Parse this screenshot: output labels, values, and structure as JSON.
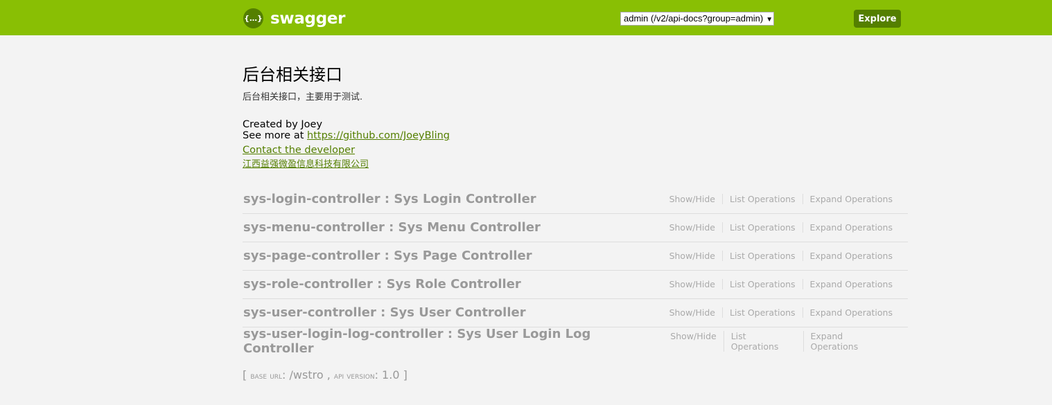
{
  "header": {
    "logo_glyph": "{…}",
    "brand": "swagger",
    "select_value": "admin (/v2/api-docs?group=admin)",
    "explore_label": "Explore",
    "color": "#89bf04"
  },
  "info": {
    "title": "后台相关接口",
    "description": "后台相关接口，主要用于测试.",
    "created_by": "Created by Joey",
    "see_more": "See more at ",
    "github_url": "https://github.com/JoeyBling",
    "contact": "Contact the developer",
    "company": "江西益强微盈信息科技有限公司"
  },
  "ops": {
    "show_hide": "Show/Hide",
    "list": "List Operations",
    "expand": "Expand Operations"
  },
  "controllers": [
    {
      "name": "sys-login-controller : Sys Login Controller"
    },
    {
      "name": "sys-menu-controller : Sys Menu Controller"
    },
    {
      "name": "sys-page-controller : Sys Page Controller"
    },
    {
      "name": "sys-role-controller : Sys Role Controller"
    },
    {
      "name": "sys-user-controller : Sys User Controller"
    },
    {
      "name": "sys-user-login-log-controller : Sys User Login Log Controller"
    }
  ],
  "footer": {
    "open": "[ ",
    "base_label": "Base URL",
    "base_url": "/wstro",
    "sep": " , ",
    "ver_label": "API Version",
    "version": "1.0",
    "close": " ]"
  }
}
